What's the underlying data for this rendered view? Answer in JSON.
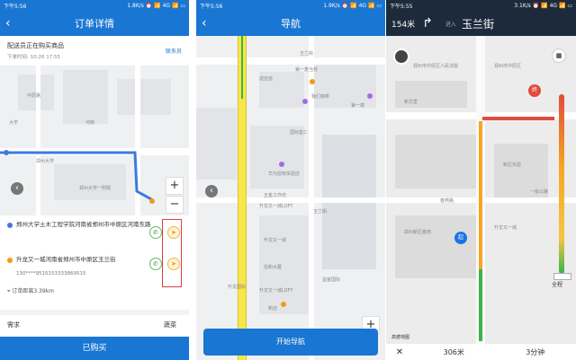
{
  "screen1": {
    "status": {
      "time": "下午5:56",
      "right": "1.8K/s ⏰ 📶 4G 📶 ▭"
    },
    "title": "订单详情",
    "order_status": "配送员正在购买商品",
    "order_time": "下单时间: 10:26 17:55",
    "contact_label": "联系员",
    "map_labels": [
      "中原路",
      "郑州大学",
      "郑州大学一附院",
      "河南",
      "大学"
    ],
    "pickup_address": "郑州大学土木工程学院河南省郑州市中原区河南东路",
    "delivery_address": "升龙又一城河南省郑州市中原区玉兰街",
    "phone": "130****9515153333869515",
    "distance_label": "订单距离3.39km",
    "remark_label": "需求",
    "remark_value": "蔬菜",
    "bottom_button": "已购买"
  },
  "screen2": {
    "status": {
      "time": "下午5:56",
      "right": "1.9K/s ⏰ 📶 4G 📶 ▭"
    },
    "title": "导航",
    "map_labels": [
      "玉兰街",
      "第一麦当劳",
      "迪亚迪",
      "第一楼",
      "国际盒仁",
      "我们咖啡",
      "华为授权体验店",
      "五金工作坊",
      "升龙又一城LOFT",
      "玉兰街",
      "升龙又一城",
      "信和大厦",
      "益客国际",
      "升龙又一城LOFT",
      "升龙国际",
      "新店"
    ],
    "start_button": "开始导航"
  },
  "screen3": {
    "status": {
      "time": "下午5:55",
      "right": "3.1K/s ⏰ 📶 4G 📶 ▭"
    },
    "distance": "154米",
    "enter_label": "进入",
    "street": "玉兰街",
    "map_labels": [
      "郑州市中原区人民法院",
      "郑州市中原区",
      "新区实验",
      "一级公路",
      "郑州新区春燕",
      "春燕路",
      "新华里",
      "升龙又一城"
    ],
    "full_view": "全程",
    "remain_distance": "306米",
    "remain_time": "3分钟",
    "logo": "高德地图"
  },
  "colors": {
    "primary": "#1976d2",
    "route": "#1a73e8",
    "traffic_yellow": "#f5c542"
  }
}
